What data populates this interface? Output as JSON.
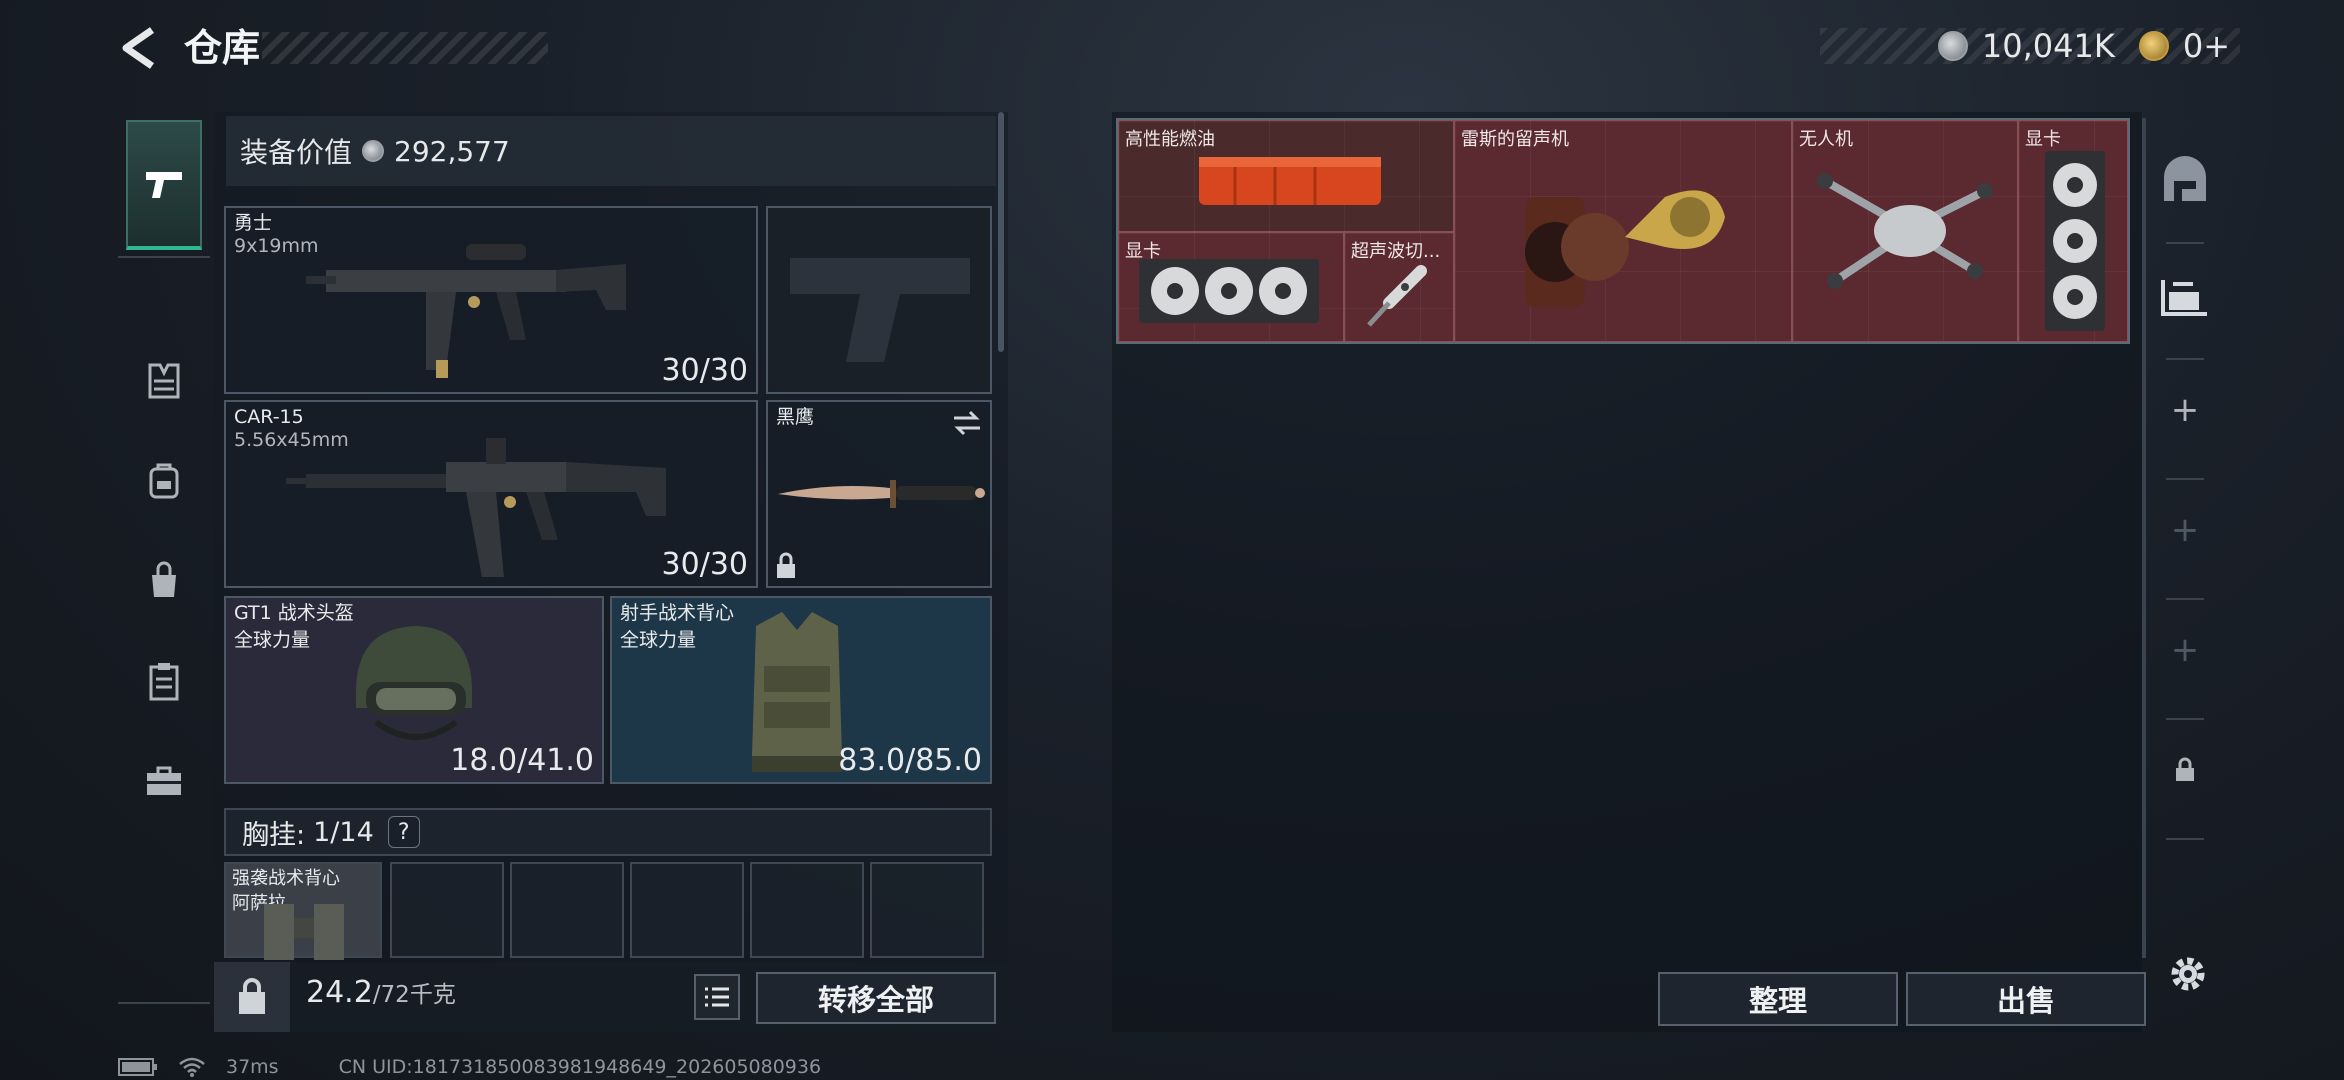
{
  "header": {
    "title": "仓库",
    "currency_silver": "10,041K",
    "currency_gold": "0+"
  },
  "left_tabs": [
    {
      "icon": "pistol-icon"
    },
    {
      "icon": "vest-icon"
    },
    {
      "icon": "backpack-icon"
    },
    {
      "icon": "bag-icon"
    },
    {
      "icon": "clipboard-icon"
    },
    {
      "icon": "briefcase-icon"
    }
  ],
  "equipment": {
    "value_label": "装备价值",
    "value": "292,577",
    "primary": {
      "name": "勇士",
      "caliber": "9x19mm",
      "ammo": "30/30"
    },
    "secondary": {
      "name": "CAR-15",
      "caliber": "5.56x45mm",
      "ammo": "30/30"
    },
    "melee": {
      "name": "黑鹰"
    },
    "helmet": {
      "name": "GT1 战术头盔",
      "faction": "全球力量",
      "durability": "18.0/41.0"
    },
    "armor": {
      "name": "射手战术背心",
      "faction": "全球力量",
      "durability": "83.0/85.0"
    },
    "chest_rig": {
      "label": "胸挂:",
      "capacity": "1/14",
      "help": "?"
    },
    "chest_item": {
      "name": "强袭战术背心",
      "faction": "阿萨拉"
    },
    "weight": "24.2",
    "weight_max": "/72千克",
    "transfer_all_label": "转移全部"
  },
  "stash": {
    "items": [
      {
        "name": "高性能燃油"
      },
      {
        "name": "雷斯的留声机"
      },
      {
        "name": "无人机"
      },
      {
        "name": "显卡"
      },
      {
        "name": "显卡"
      },
      {
        "name": "超声波切..."
      }
    ],
    "sort_label": "整理",
    "sell_label": "出售"
  },
  "status_bar": {
    "ping": "37ms",
    "uid": "CN UID:18173185008398194864​9_202605080936"
  },
  "colors": {
    "accent": "#2fb890",
    "stash_item_bg": "#5a2a30"
  }
}
